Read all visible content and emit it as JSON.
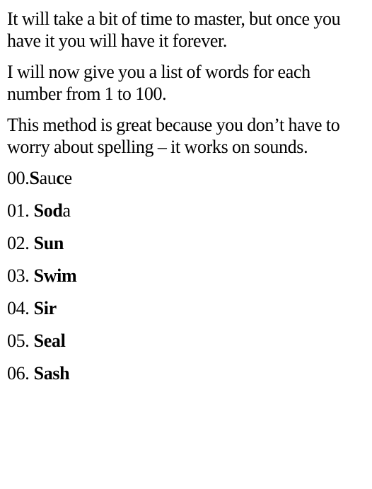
{
  "paragraphs": [
    "It will take a bit of time to master, but once you have it you will have it forever.",
    "I will now give you a list of words for each number from 1 to 100.",
    "This method is great because you don’t have to worry about spelling – it works on sounds."
  ],
  "list": [
    {
      "num": "00.",
      "bold_a": "S",
      "plain_a": "au",
      "bold_b": "c",
      "plain_b": "e"
    },
    {
      "num": "01. ",
      "bold_a": "So",
      "plain_a": "",
      "bold_b": "d",
      "plain_b": "a"
    },
    {
      "num": "02. ",
      "bold_a": "Su",
      "plain_a": "",
      "bold_b": "n",
      "plain_b": ""
    },
    {
      "num": "03. ",
      "bold_a": "Swi",
      "plain_a": "",
      "bold_b": "m",
      "plain_b": ""
    },
    {
      "num": "04. ",
      "bold_a": "Si",
      "plain_a": "",
      "bold_b": "r",
      "plain_b": ""
    },
    {
      "num": "05. ",
      "bold_a": "Sea",
      "plain_a": "",
      "bold_b": "l",
      "plain_b": ""
    },
    {
      "num": "06. ",
      "bold_a": "Sa",
      "plain_a": "",
      "bold_b": "sh",
      "plain_b": ""
    }
  ]
}
